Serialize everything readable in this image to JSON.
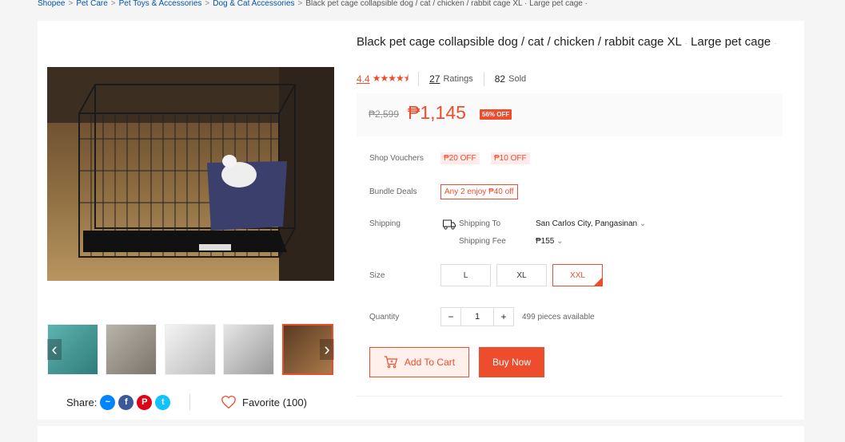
{
  "breadcrumb": {
    "items": [
      "Shopee",
      "Pet Care",
      "Pet Toys & Accessories",
      "Dog & Cat Accessories"
    ],
    "current": "Black pet cage collapsible dog / cat / chicken / rabbit cage XL · Large pet cage ·"
  },
  "product": {
    "title_part1": "Black pet cage collapsible dog / cat / chicken / rabbit cage XL",
    "title_part2": "Large pet cage",
    "rating": "4.4",
    "rating_stars": 4.4,
    "ratings_count": "27",
    "ratings_label": "Ratings",
    "sold_count": "82",
    "sold_label": "Sold"
  },
  "price": {
    "original": "₱2,599",
    "current": "₱1,145",
    "discount": "56% OFF"
  },
  "vouchers": {
    "label": "Shop Vouchers",
    "items": [
      "₱20 OFF",
      "₱10 OFF"
    ]
  },
  "bundle": {
    "label": "Bundle Deals",
    "text": "Any 2 enjoy ₱40 off"
  },
  "shipping": {
    "label": "Shipping",
    "to_label": "Shipping To",
    "to_value": "San Carlos City, Pangasinan",
    "fee_label": "Shipping Fee",
    "fee_value": "₱155"
  },
  "size": {
    "label": "Size",
    "options": [
      "L",
      "XL",
      "XXL"
    ],
    "selected": "XXL"
  },
  "quantity": {
    "label": "Quantity",
    "value": "1",
    "minus": "−",
    "plus": "+",
    "available": "499 pieces available"
  },
  "actions": {
    "add_to_cart": "Add To Cart",
    "buy_now": "Buy Now"
  },
  "share": {
    "label": "Share:",
    "favorite": "Favorite (100)"
  },
  "colors": {
    "brand": "#ee4d2d",
    "link": "#0055aa"
  }
}
